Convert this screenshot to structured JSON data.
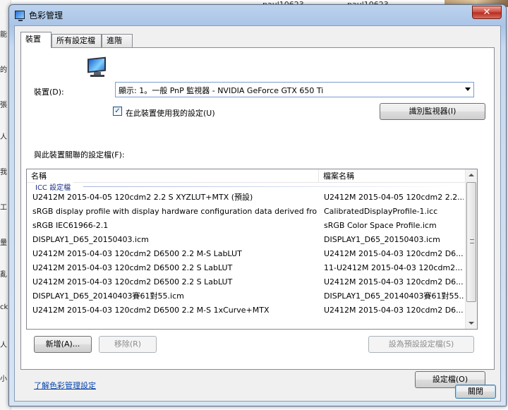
{
  "background": {
    "users": [
      "paul10623",
      "paul10623"
    ],
    "left_chars": [
      "能",
      "的",
      "張",
      "人",
      "我",
      "工",
      "量",
      "亂",
      "ck",
      "人",
      "小"
    ]
  },
  "window": {
    "title": "色彩管理",
    "close_glyph": "✕"
  },
  "tabs": [
    "裝置",
    "所有設定檔",
    "進階"
  ],
  "device": {
    "label": "裝置(D):",
    "selected": "顯示: 1。一般 PnP 監視器 - NVIDIA GeForce GTX 650 Ti",
    "use_settings_label": "在此裝置使用我的設定(U)",
    "use_settings_checked": true,
    "identify_button": "識別監視器(I)"
  },
  "profiles": {
    "section_label": "與此裝置關聯的設定檔(F):",
    "columns": [
      "名稱",
      "檔案名稱"
    ],
    "group_title": "ICC 設定檔",
    "rows": [
      {
        "name": "U2412M 2015-04-05 120cdm2 2.2 S XYZLUT+MTX (預設)",
        "file": "U2412M 2015-04-05 120cdm2 2.2..."
      },
      {
        "name": "sRGB display profile with display hardware configuration data derived fro...",
        "file": "CalibratedDisplayProfile-1.icc"
      },
      {
        "name": "sRGB IEC61966-2.1",
        "file": "sRGB Color Space Profile.icm"
      },
      {
        "name": "DISPLAY1_D65_20150403.icm",
        "file": "DISPLAY1_D65_20150403.icm"
      },
      {
        "name": "U2412M 2015-04-03 120cdm2 D6500 2.2 M-S LabLUT",
        "file": "U2412M 2015-04-03 120cdm2 D6..."
      },
      {
        "name": "U2412M 2015-04-03 120cdm2 D6500 2.2 S LabLUT",
        "file": "11-U2412M 2015-04-03 120cdm2..."
      },
      {
        "name": "U2412M 2015-04-03 120cdm2 D6500 2.2 S LabLUT",
        "file": "U2412M 2015-04-03 120cdm2 D6..."
      },
      {
        "name": "DISPLAY1_D65_20140403賽61對55.icm",
        "file": "DISPLAY1_D65_20140403賽61對55..."
      },
      {
        "name": "U2412M 2015-04-03 120cdm2 D6500 2.2 M-S 1xCurve+MTX",
        "file": "U2412M 2015-04-03 120cdm2 D6..."
      }
    ]
  },
  "buttons": {
    "add": "新增(A)...",
    "remove": "移除(R)",
    "set_default": "設為預設設定檔(S)",
    "profiles": "設定檔(O)",
    "close": "關閉"
  },
  "link": {
    "learn": "了解色彩管理設定"
  }
}
